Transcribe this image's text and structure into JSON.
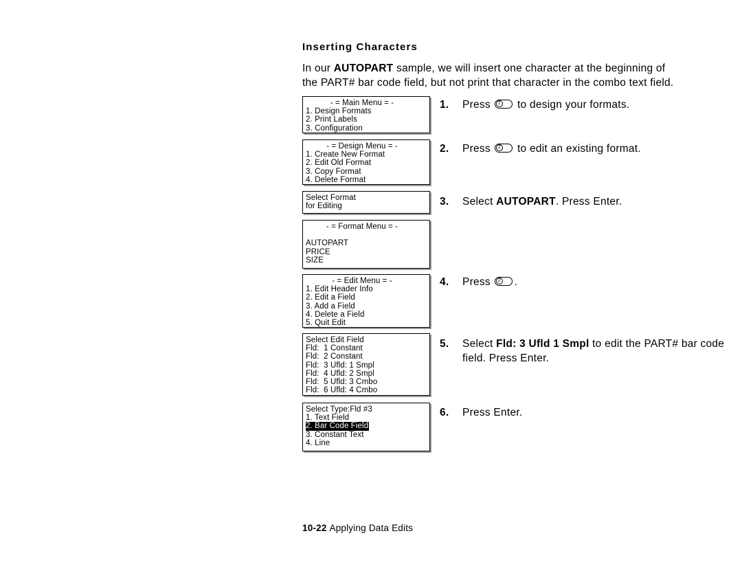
{
  "section": {
    "heading": "Inserting Characters"
  },
  "intro": {
    "line1_pre": "In our ",
    "line1_bold": "AUTOPART",
    "line1_post": " sample, we will insert one character at the beginning of",
    "line2": "the PART# bar code field, but not print that character in the combo text field."
  },
  "lcd_screens": [
    {
      "id": "main-menu",
      "header": "- = Main Menu = -",
      "rows": [
        "1. Design Formats",
        "2. Print Labels",
        "3. Configuration"
      ]
    },
    {
      "id": "design-menu",
      "header": "- = Design Menu = -",
      "rows": [
        "1. Create New Format",
        "2. Edit Old Format",
        "3. Copy Format",
        "4. Delete Format"
      ]
    },
    {
      "id": "select-format",
      "header": "",
      "rows": [
        "Select Format",
        "for Editing"
      ]
    },
    {
      "id": "format-menu",
      "header": "- = Format Menu = -",
      "rows": [
        "",
        "AUTOPART",
        "PRICE",
        "SIZE"
      ]
    },
    {
      "id": "edit-menu",
      "header": "- = Edit Menu = -",
      "rows": [
        "1. Edit Header Info",
        "2. Edit a Field",
        "3. Add a Field",
        "4. Delete a Field",
        "5. Quit Edit"
      ]
    },
    {
      "id": "select-edit-field",
      "header": "",
      "rows": [
        "Select Edit Field",
        "Fld:  1 Constant",
        "Fld:  2 Constant",
        "Fld:  3 Ufld: 1 Smpl",
        "Fld:  4 Ufld: 2 Smpl",
        "Fld:  5 Ufld: 3 Cmbo",
        "Fld:  6 Ufld: 4 Cmbo"
      ]
    },
    {
      "id": "select-type",
      "header": "",
      "rows": [
        "Select Type:Fld #3",
        "1. Text Field",
        "2. Bar Code Field",
        "3. Constant Text",
        "4. Line"
      ],
      "selected_row_index": 2,
      "selected_text": "2. Bar Code Field"
    }
  ],
  "steps": [
    {
      "num": "1.",
      "pre": "Press ",
      "key": "1",
      "post": " to design your formats."
    },
    {
      "num": "2.",
      "pre": "Press ",
      "key": "2",
      "post": " to edit an existing format."
    },
    {
      "num": "3.",
      "pre": "Select ",
      "bold": "AUTOPART",
      "post": ".  Press Enter."
    },
    {
      "num": "4.",
      "pre": "Press ",
      "key": "2",
      "post": "."
    },
    {
      "num": "5.",
      "pre": "Select ",
      "bold": "Fld:  3 Ufld 1 Smpl",
      "post": " to edit the PART# bar code field.  Press Enter."
    },
    {
      "num": "6.",
      "pre": "Press Enter.",
      "post": ""
    }
  ],
  "footer": {
    "page_number": "10-22",
    "chapter_title": "Applying Data Edits"
  }
}
